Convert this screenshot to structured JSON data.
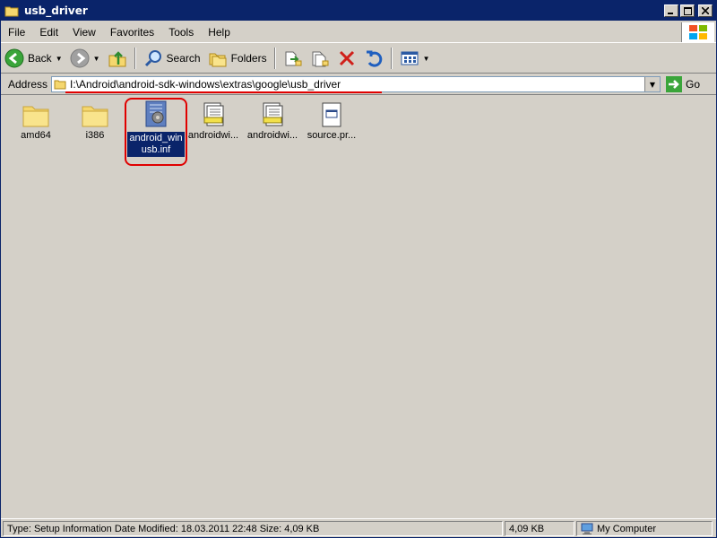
{
  "window": {
    "title": "usb_driver"
  },
  "menu": {
    "items": [
      "File",
      "Edit",
      "View",
      "Favorites",
      "Tools",
      "Help"
    ]
  },
  "toolbar": {
    "back_label": "Back",
    "search_label": "Search",
    "folders_label": "Folders"
  },
  "address": {
    "label": "Address",
    "path": "I:\\Android\\android-sdk-windows\\extras\\google\\usb_driver",
    "go_label": "Go"
  },
  "files": [
    {
      "name": "amd64",
      "type": "folder-icon"
    },
    {
      "name": "i386",
      "type": "folder-icon"
    },
    {
      "name": "android_winusb.inf",
      "display": "android_win\nusb.inf",
      "type": "setup-info-icon",
      "selected": true
    },
    {
      "name": "androidwi...",
      "type": "installer-icon"
    },
    {
      "name": "androidwi...",
      "type": "installer-icon"
    },
    {
      "name": "source.pr...",
      "type": "properties-file-icon"
    }
  ],
  "status": {
    "info": "Type: Setup Information Date Modified: 18.03.2011 22:48 Size: 4,09 KB",
    "size": "4,09 KB",
    "zone": "My Computer"
  },
  "colors": {
    "accent": "#0a246a",
    "highlight": "#e00000",
    "background": "#d4d0c8"
  }
}
